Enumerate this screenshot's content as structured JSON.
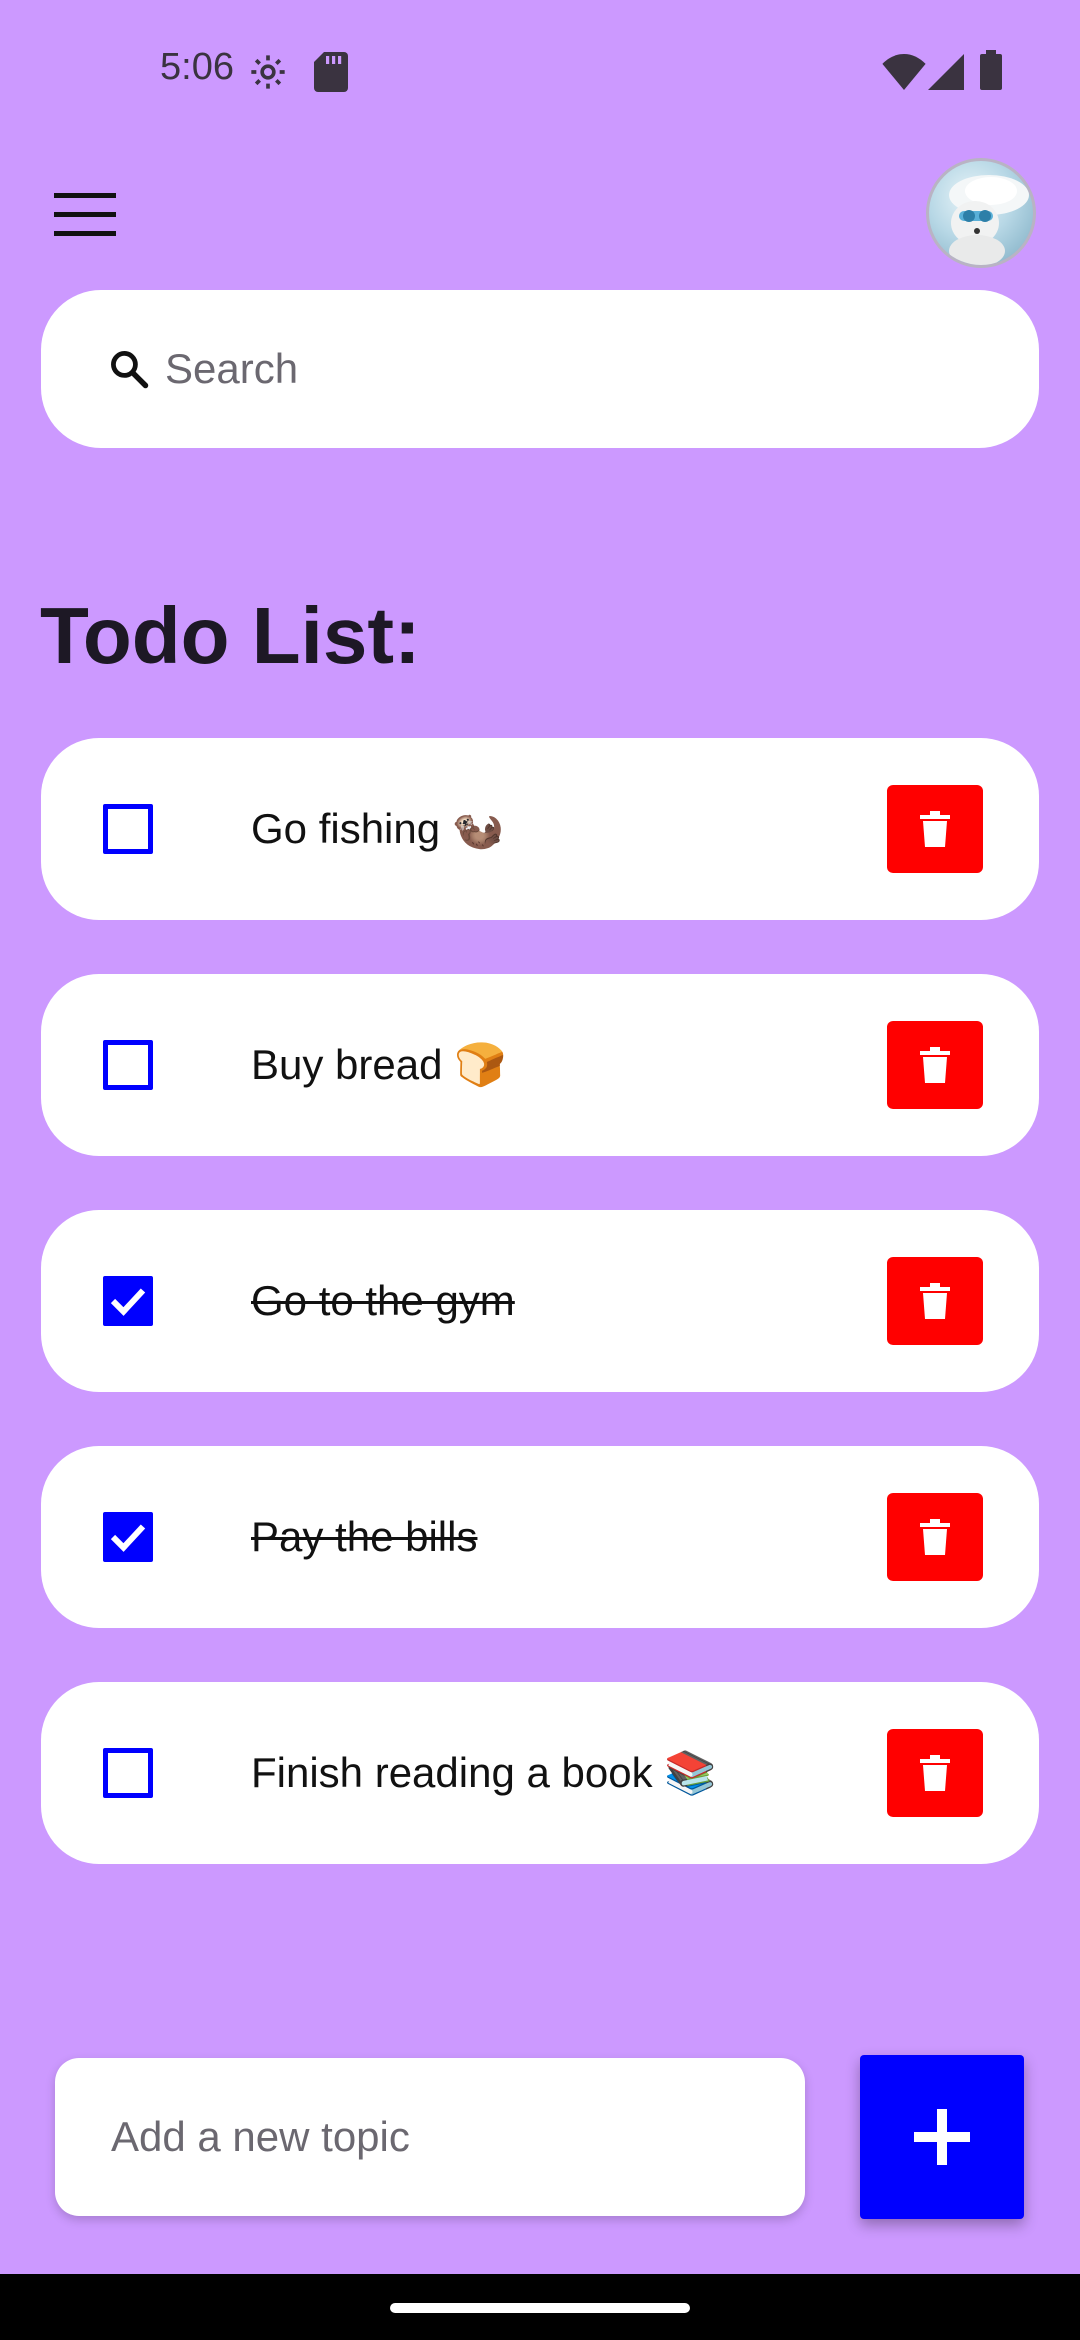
{
  "status_bar": {
    "time": "5:06",
    "icons": [
      "settings-icon",
      "sd-card-icon",
      "wifi-icon",
      "signal-icon",
      "battery-icon"
    ]
  },
  "header": {
    "menu_icon": "hamburger-menu-icon",
    "avatar": "profile-avatar"
  },
  "search": {
    "placeholder": "Search",
    "value": "",
    "icon": "search-icon"
  },
  "title": "Todo List:",
  "todos": [
    {
      "text": "Go fishing 🦦",
      "done": false
    },
    {
      "text": "Buy bread 🍞",
      "done": false
    },
    {
      "text": "Go to the gym",
      "done": true
    },
    {
      "text": "Pay the bills",
      "done": true
    },
    {
      "text": "Finish reading a book 📚",
      "done": false
    }
  ],
  "add_topic": {
    "placeholder": "Add a new topic",
    "value": ""
  },
  "colors": {
    "background": "#CC99FF",
    "accent": "#0000FF",
    "delete": "#FF0000",
    "card": "#FFFFFF"
  }
}
